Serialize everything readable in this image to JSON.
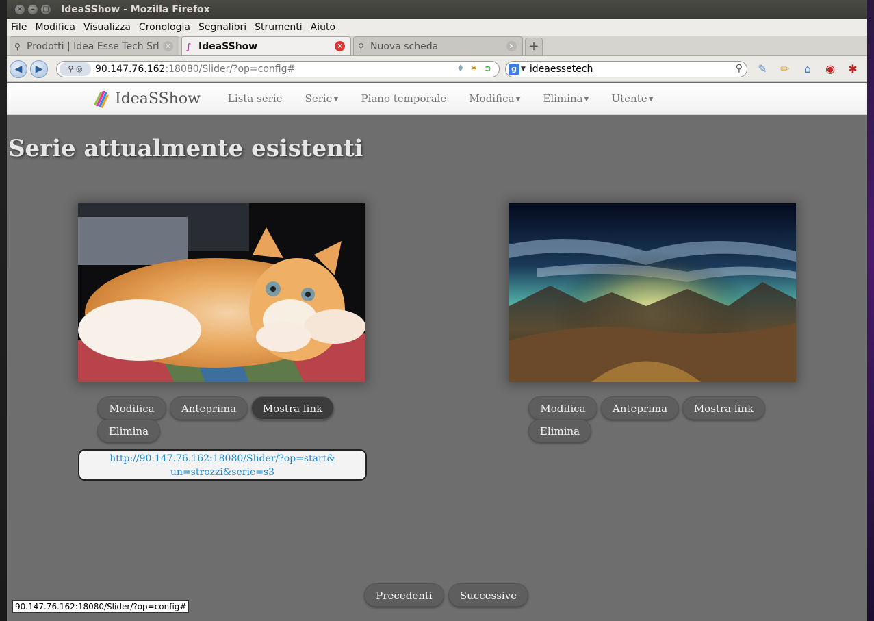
{
  "window": {
    "title": "IdeaSShow - Mozilla Firefox"
  },
  "menubar": [
    "File",
    "Modifica",
    "Visualizza",
    "Cronologia",
    "Segnalibri",
    "Strumenti",
    "Aiuto"
  ],
  "tabs": [
    {
      "label": "Prodotti | Idea Esse Tech Srl",
      "active": false
    },
    {
      "label": "IdeaSShow",
      "active": true
    },
    {
      "label": "Nuova scheda",
      "active": false
    }
  ],
  "urlbar": {
    "host": "90.147.76.162",
    "path": ":18080/Slider/?op=config#"
  },
  "searchbar": {
    "value": "ideaessetech"
  },
  "app": {
    "brand": "IdeaSShow",
    "nav": {
      "lista_serie": "Lista serie",
      "serie": "Serie",
      "piano_temporale": "Piano temporale",
      "modifica": "Modifica",
      "elimina": "Elimina",
      "utente": "Utente"
    }
  },
  "page": {
    "title": "Serie attualmente esistenti"
  },
  "cards": [
    {
      "image": "kitten-photo",
      "buttons": {
        "modifica": "Modifica",
        "anteprima": "Anteprima",
        "mostra_link": "Mostra link",
        "elimina": "Elimina"
      },
      "link_line1": "http://90.147.76.162:18080/Slider/?op=start&",
      "link_line2": "un=strozzi&serie=s3"
    },
    {
      "image": "landscape-sky-photo",
      "buttons": {
        "modifica": "Modifica",
        "anteprima": "Anteprima",
        "mostra_link": "Mostra link",
        "elimina": "Elimina"
      }
    }
  ],
  "pagination": {
    "prev": "Precedenti",
    "next": "Successive"
  },
  "status": {
    "url": "90.147.76.162:18080/Slider/?op=config#"
  }
}
